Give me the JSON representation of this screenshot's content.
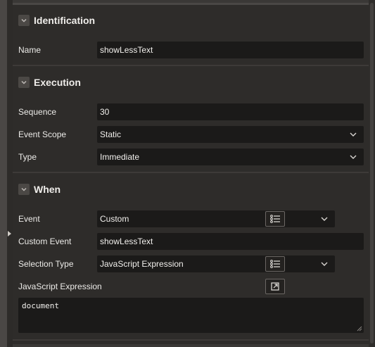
{
  "sections": {
    "identification": {
      "title": "Identification",
      "name_label": "Name",
      "name_value": "showLessText"
    },
    "execution": {
      "title": "Execution",
      "sequence_label": "Sequence",
      "sequence_value": "30",
      "event_scope_label": "Event Scope",
      "event_scope_value": "Static",
      "type_label": "Type",
      "type_value": "Immediate"
    },
    "when": {
      "title": "When",
      "event_label": "Event",
      "event_value": "Custom",
      "custom_event_label": "Custom Event",
      "custom_event_value": "showLessText",
      "selection_type_label": "Selection Type",
      "selection_type_value": "JavaScript Expression",
      "js_expression_label": "JavaScript Expression",
      "js_expression_value": "document"
    }
  },
  "icons": {
    "toggle": "chevron-down-icon",
    "select_caret": "chevron-down-icon",
    "list_button": "list-icon",
    "expand_editor": "open-external-icon"
  },
  "colors": {
    "panel_bg": "#2e2c2a",
    "field_bg": "#1b1a19",
    "text": "#ecebe8"
  }
}
